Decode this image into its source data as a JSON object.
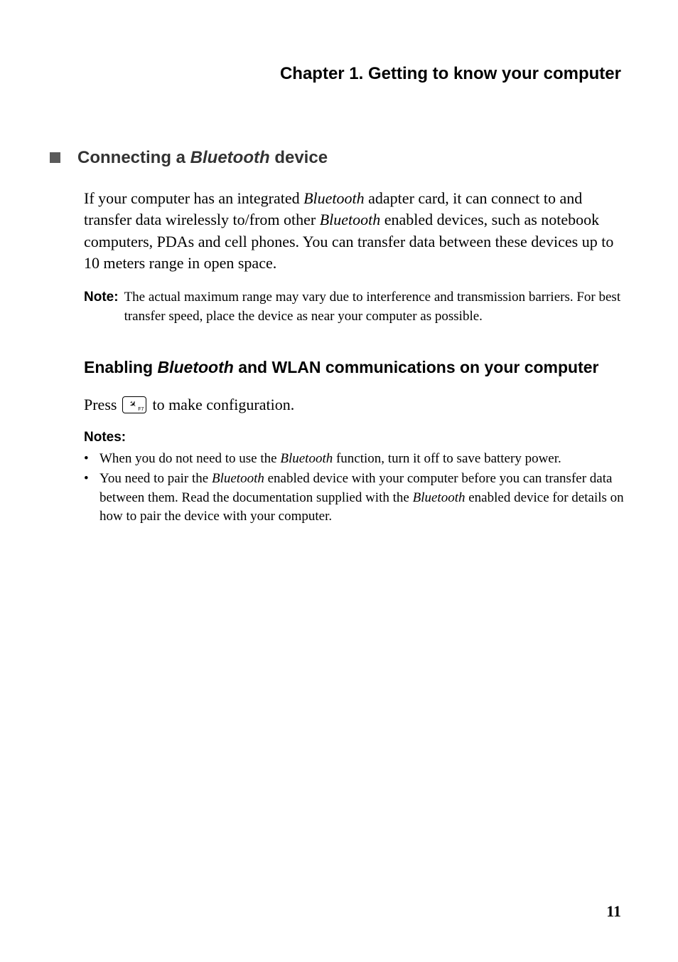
{
  "header": {
    "chapter": "Chapter 1. Getting to know your computer"
  },
  "section1": {
    "title_pre": "Connecting a ",
    "title_italic": "Bluetooth",
    "title_post": " device",
    "body_1a": "If your computer has an integrated ",
    "body_1b": "Bluetooth",
    "body_1c": " adapter card, it can connect to and transfer data wirelessly to/from other ",
    "body_1d": "Bluetooth",
    "body_1e": " enabled devices, such as notebook computers, PDAs and cell phones. You can transfer data between these devices up to 10 meters range in open space.",
    "note_label": "Note:",
    "note_body": "The actual maximum range may vary due to interference and transmission barriers. For best transfer speed, place the device as near your computer as possible."
  },
  "section2": {
    "heading_pre": "Enabling ",
    "heading_italic": "Bluetooth",
    "heading_post": " and WLAN communications on your computer",
    "press_pre": "Press ",
    "press_post": " to make configuration.",
    "key_sub": "F7",
    "notes_label": "Notes:",
    "note_items": [
      {
        "a": "When you do not need to use the ",
        "b": "Bluetooth",
        "c": " function, turn it off to save battery power."
      },
      {
        "a": "You need to pair the ",
        "b": "Bluetooth",
        "c": " enabled device with your computer before you can transfer data between them. Read the documentation supplied with the ",
        "d": "Bluetooth",
        "e": " enabled device for details on how to pair the device with your computer."
      }
    ]
  },
  "page_number": "11"
}
